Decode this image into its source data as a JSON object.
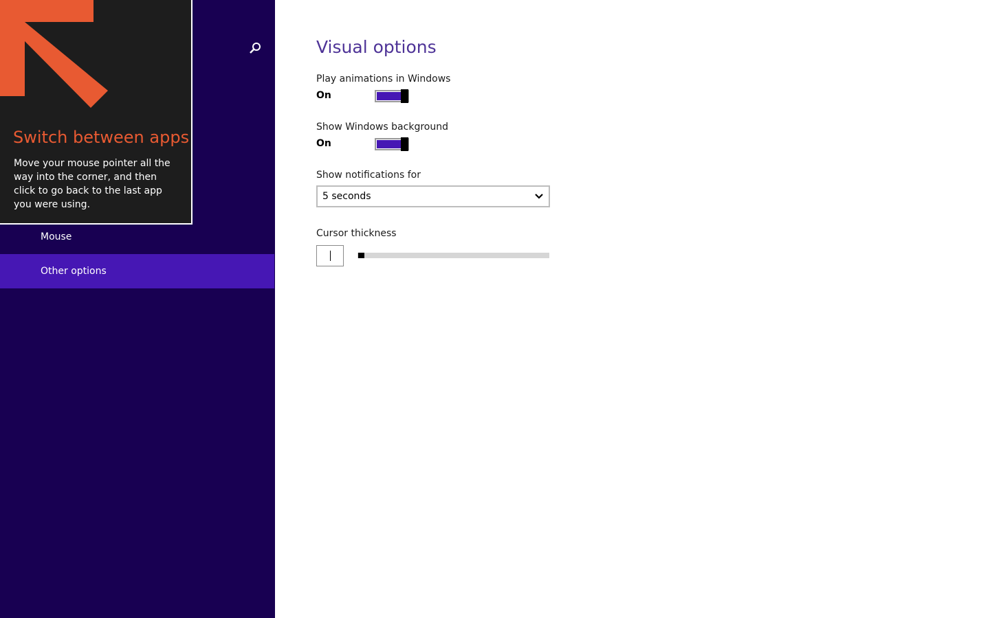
{
  "tip": {
    "title": "Switch between apps",
    "body": "Move your mouse pointer all the way into the corner, and then click to go back to the last app you were using."
  },
  "sidebar": {
    "search_icon": "search-icon",
    "items": [
      {
        "label": "Mouse",
        "selected": false
      },
      {
        "label": "Other options",
        "selected": true
      }
    ]
  },
  "main": {
    "title": "Visual options",
    "animations": {
      "label": "Play animations in Windows",
      "state": "On"
    },
    "background": {
      "label": "Show Windows background",
      "state": "On"
    },
    "notifications": {
      "label": "Show notifications for",
      "value": "5 seconds"
    },
    "cursor": {
      "label": "Cursor thickness",
      "level": 1
    }
  },
  "colors": {
    "sidebar_bg": "#180052",
    "accent": "#4617b4",
    "title": "#4e3397",
    "tip_title": "#e85a32"
  }
}
